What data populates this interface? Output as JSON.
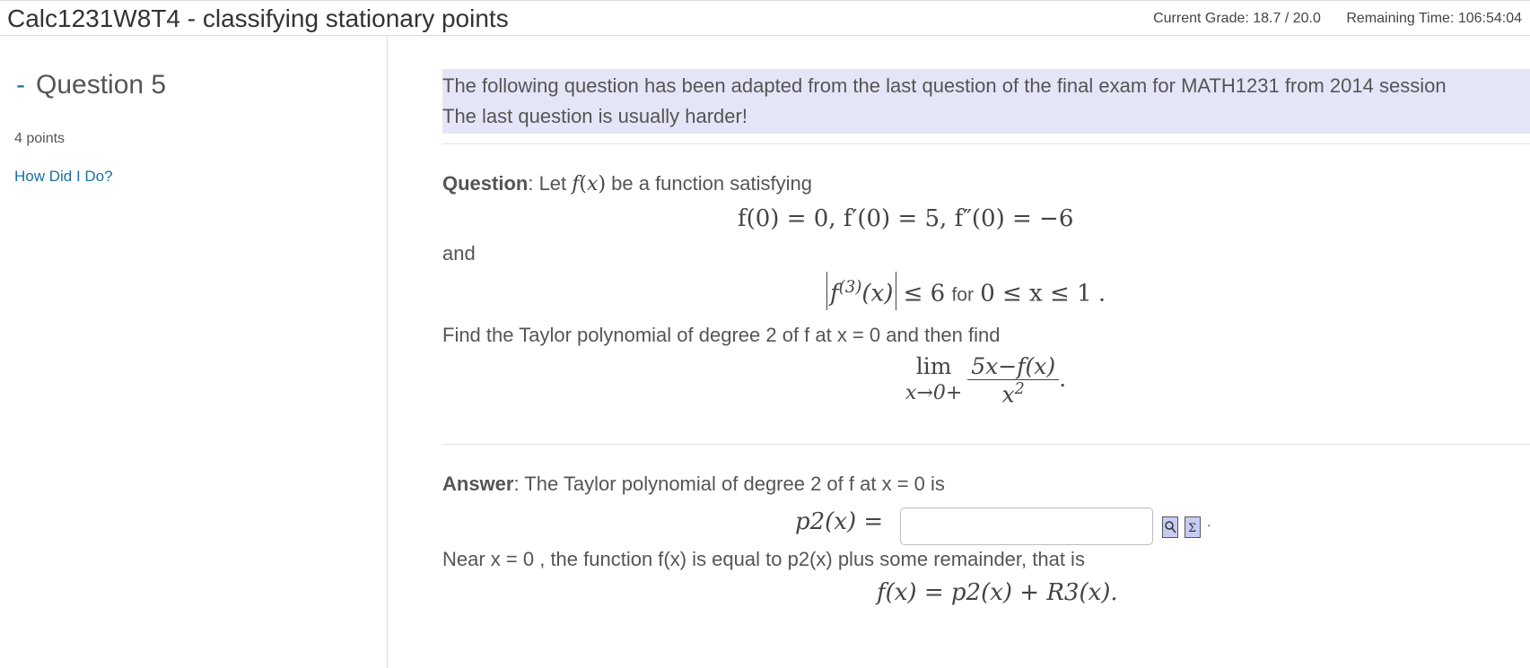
{
  "header": {
    "title": "Calc1231W8T4 - classifying stationary points",
    "grade": "Current Grade: 18.7 / 20.0",
    "time": "Remaining Time:  106:54:04"
  },
  "sidebar": {
    "dash": "-",
    "question": "Question 5",
    "points": "4 points",
    "link": "How Did I Do?"
  },
  "main": {
    "intro_line1": "The following question has been adapted from the last question of the final exam for MATH1231 from 2014 session",
    "intro_line2": "The last question is usually harder!",
    "q_label": "Question",
    "q_let": ": Let ",
    "q_satisfy": " be a function satisfying",
    "eq1": "f(0) = 0,   f′(0) = 5,   f″(0) = −6",
    "and": "and",
    "bound_ineq": "≤ 6",
    "bound_for": "for",
    "bound_range": "0 ≤ x ≤ 1",
    "find": "Find the Taylor polynomial of degree 2 of f at x = 0 and then find",
    "lim_word": "lim",
    "lim_sub": "x→0+",
    "frac_num": "5x−f(x)",
    "frac_den_var": "x",
    "frac_den_pow": "2",
    "a_label": "Answer",
    "a_text": ": The Taylor polynomial of degree 2 of f  at x = 0  is",
    "p2_label": "p2(x) =",
    "p2_value": "",
    "near": "Near x = 0 , the function f(x) is equal to p2(x) plus some remainder, that is",
    "last_eq": "f(x) = p2(x) + R3(x)."
  }
}
